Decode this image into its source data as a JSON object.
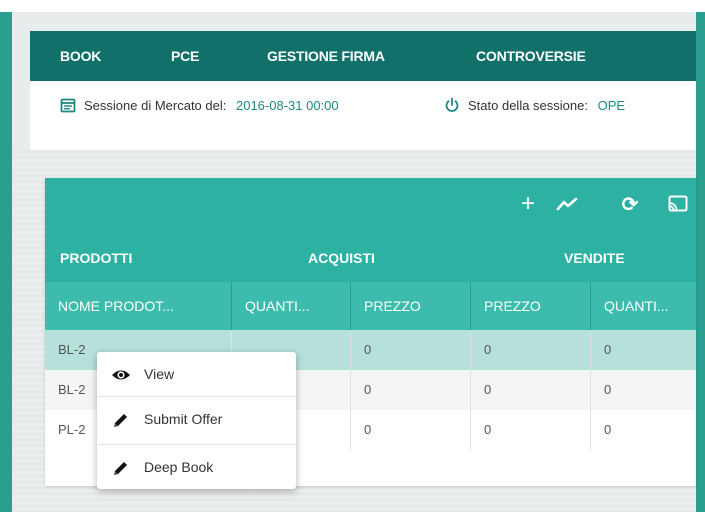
{
  "nav": {
    "items": [
      {
        "label": "BOOK"
      },
      {
        "label": "PCE"
      },
      {
        "label": "GESTIONE FIRMA"
      },
      {
        "label": "CONTROVERSIE"
      }
    ]
  },
  "session": {
    "market_label": "Sessione di Mercato del:",
    "market_value": "2016-08-31 00:00",
    "status_label": "Stato della sessione:",
    "status_value": "OPE"
  },
  "toolbar": {
    "icons": [
      "plus-icon",
      "trend-chart-icon",
      "refresh-icon",
      "cast-icon"
    ],
    "plus_glyph": "+",
    "refresh_glyph": "⟳"
  },
  "groups": [
    "PRODOTTI",
    "ACQUISTI",
    "VENDITE"
  ],
  "columns": [
    "NOME PRODOT...",
    "QUANTI...",
    "PREZZO",
    "PREZZO",
    "QUANTI..."
  ],
  "rows": [
    [
      "BL-2",
      "",
      "0",
      "0",
      "0"
    ],
    [
      "BL-2",
      "",
      "0",
      "0",
      "0"
    ],
    [
      "PL-2",
      "",
      "0",
      "0",
      "0"
    ]
  ],
  "context_menu": {
    "items": [
      {
        "label": "View",
        "icon": "eye-icon"
      },
      {
        "label": "Submit Offer",
        "icon": "pencil-icon"
      },
      {
        "label": "Deep Book",
        "icon": "pencil-icon"
      }
    ]
  },
  "colors": {
    "nav_bg": "#12706a",
    "header_bg": "#2db1a2",
    "column_header_bg": "#3dbcae",
    "selected_row_bg": "#b6e1da",
    "accent_text": "#1e8a80"
  }
}
